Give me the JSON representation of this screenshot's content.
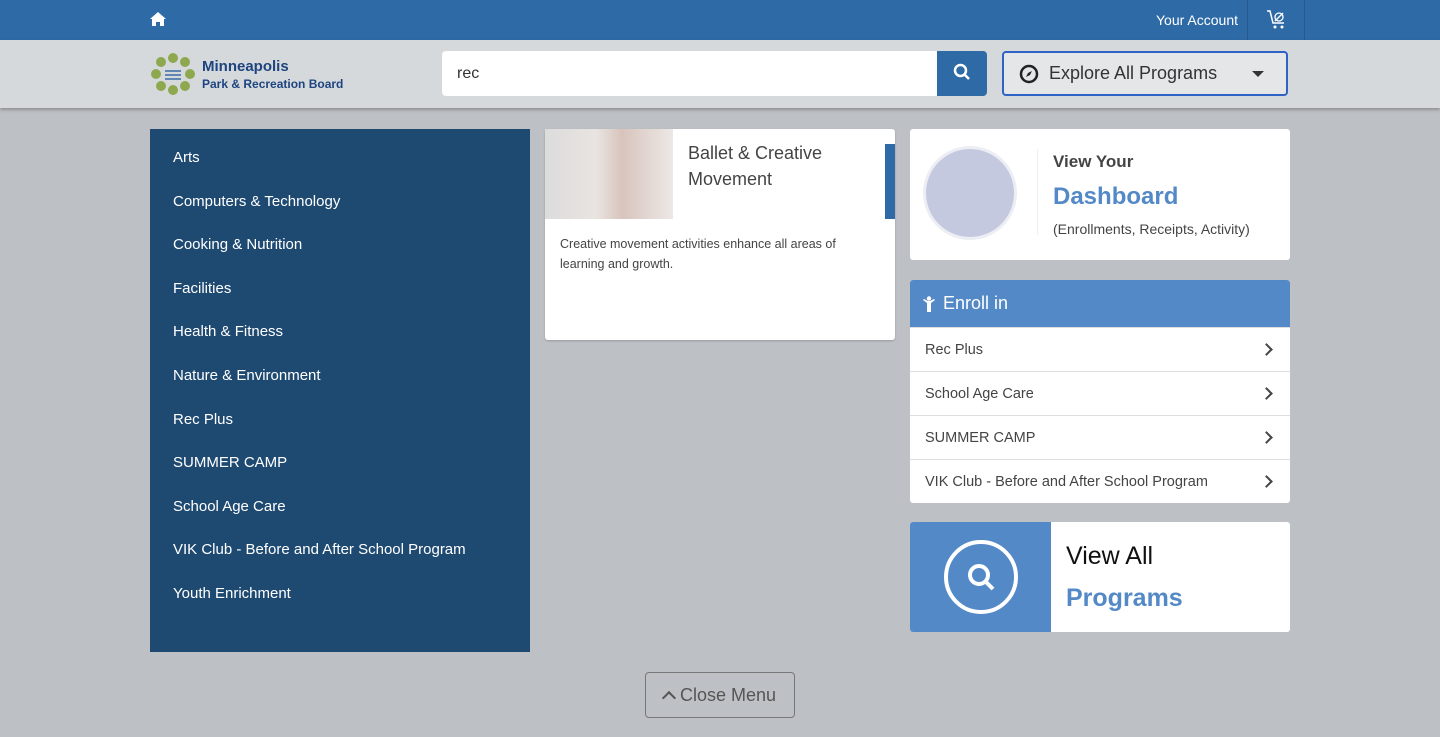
{
  "topbar": {
    "account": "Your Account"
  },
  "logo": {
    "line1": "Minneapolis",
    "line2": "Park & Recreation Board"
  },
  "search": {
    "value": "rec"
  },
  "explore": {
    "label": "Explore All Programs"
  },
  "categories": [
    "Arts",
    "Computers & Technology",
    "Cooking & Nutrition",
    "Facilities",
    "Health & Fitness",
    "Nature & Environment",
    "Rec Plus",
    "SUMMER CAMP",
    "School Age Care",
    "VIK Club - Before and After School Program",
    "Youth Enrichment"
  ],
  "program_card": {
    "title": "Ballet & Creative Movement",
    "description": "Creative movement activities enhance all areas of learning and growth."
  },
  "dashboard": {
    "view": "View Your",
    "title": "Dashboard",
    "subtitle": "(Enrollments, Receipts, Activity)"
  },
  "enroll": {
    "header": "Enroll in",
    "items": [
      "Rec Plus",
      "School Age Care",
      "SUMMER CAMP",
      "VIK Club - Before and After School Program"
    ]
  },
  "view_all": {
    "line1": "View All",
    "line2": "Programs"
  },
  "close_menu": "Close Menu",
  "colors": {
    "topbar": "#2d6aa6",
    "sidebar": "#1e4a72",
    "accent": "#5489c7"
  }
}
